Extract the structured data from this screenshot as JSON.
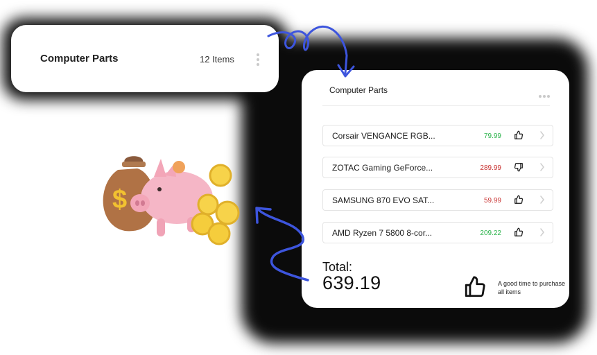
{
  "summary_card": {
    "title": "Computer Parts",
    "count": "12 Items"
  },
  "detail_card": {
    "title": "Computer Parts",
    "items": [
      {
        "name": "Corsair VENGANCE RGB...",
        "price": "79.99",
        "trend": "up",
        "thumb": "thumbs-up"
      },
      {
        "name": "ZOTAC Gaming GeForce...",
        "price": "289.99",
        "trend": "down",
        "thumb": "thumbs-down"
      },
      {
        "name": "SAMSUNG 870 EVO SAT...",
        "price": "59.99",
        "trend": "down",
        "thumb": "thumbs-up"
      },
      {
        "name": "AMD Ryzen 7 5800 8-cor...",
        "price": "209.22",
        "trend": "up",
        "thumb": "thumbs-up"
      }
    ],
    "total_label": "Total:",
    "total_value": "639.19",
    "advice": "A good time to purchase all items"
  },
  "colors": {
    "accent_arrow": "#3d55dd",
    "price_up": "#2bb34b",
    "price_down": "#c8302f"
  },
  "icons": [
    "kebab-icon",
    "more-dots-icon",
    "thumbs-up-icon",
    "thumbs-down-icon",
    "chevron-right-icon",
    "piggy-bank-illustration",
    "money-bag-illustration",
    "coins-illustration"
  ]
}
